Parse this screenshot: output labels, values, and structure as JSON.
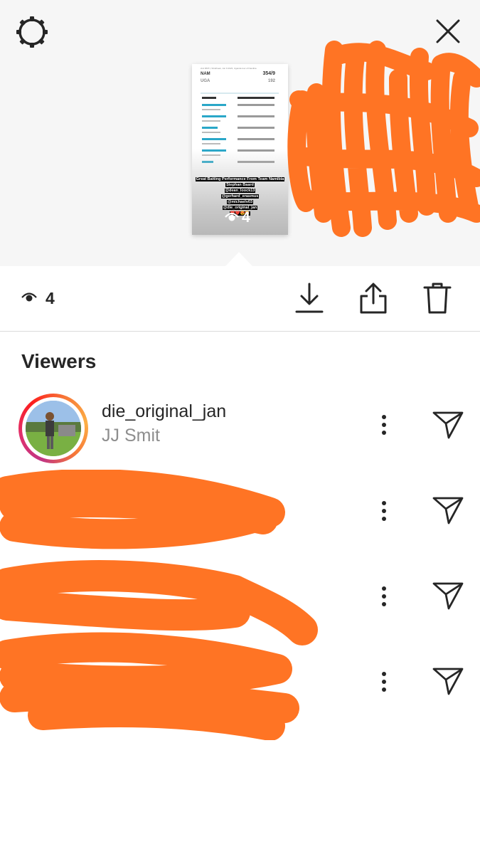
{
  "top": {
    "settings_icon": "gear-icon",
    "close_icon": "close-icon"
  },
  "story_thumbnail": {
    "team1": "NAM",
    "team1_score": "354/9",
    "team2": "UGA",
    "team2_score": "192",
    "caption_lines": [
      "Great Batting Performance From Team Namibia",
      "Stephan Baard",
      "@dean_loock13",
      "@gerhard_erasmus",
      "@michaelv03",
      "@die_original_jan",
      "❤️❤️😍😍"
    ],
    "view_count": "4"
  },
  "toolbar": {
    "views_icon": "eye-icon",
    "view_count": "4",
    "download_icon": "download-icon",
    "share_icon": "share-icon",
    "delete_icon": "trash-icon"
  },
  "viewers": {
    "title": "Viewers",
    "items": [
      {
        "username": "die_original_jan",
        "full_name": "JJ Smit",
        "redacted": false
      },
      {
        "username": "",
        "full_name": "",
        "redacted": true
      },
      {
        "username": "",
        "full_name": "",
        "redacted": true
      },
      {
        "username": "",
        "full_name": "",
        "redacted": true
      }
    ]
  },
  "colors": {
    "redaction": "#ff7424",
    "text_primary": "#262626",
    "text_secondary": "#8e8e8e",
    "divider": "#dbdbdb"
  }
}
